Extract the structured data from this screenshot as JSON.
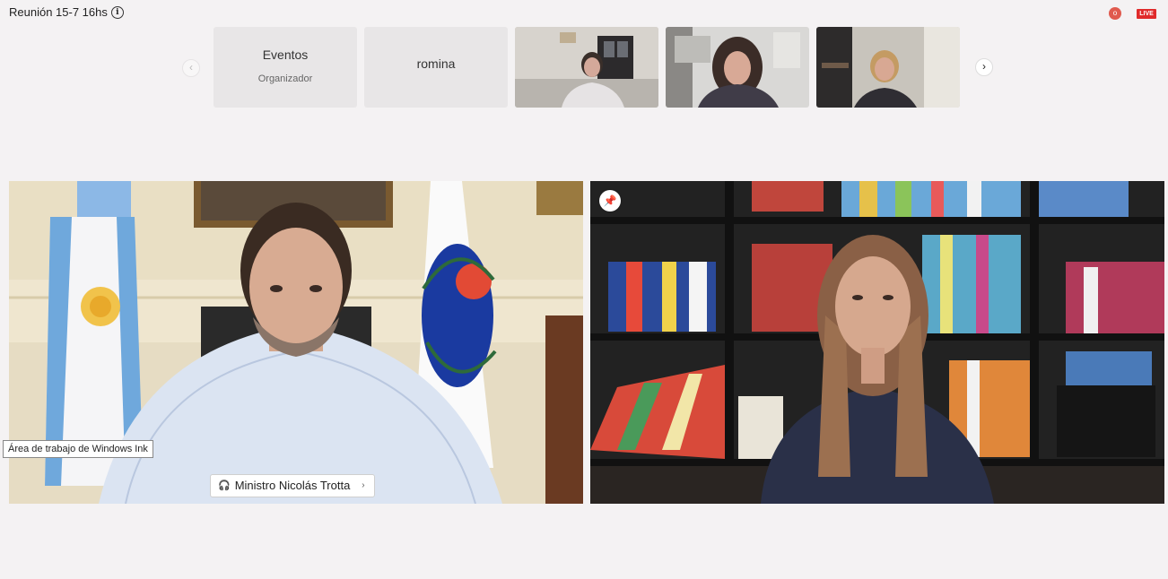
{
  "meeting": {
    "title": "Reunión 15-7 16hs"
  },
  "indicators": {
    "rec_label": "o",
    "live_label": "LIVE"
  },
  "navigation": {
    "prev_icon": "‹",
    "next_icon": "›"
  },
  "participants_strip": [
    {
      "type": "text",
      "name": "Eventos",
      "role": "Organizador"
    },
    {
      "type": "text",
      "name": "romina",
      "role": ""
    },
    {
      "type": "video",
      "name": ""
    },
    {
      "type": "video",
      "name": ""
    },
    {
      "type": "video",
      "name": ""
    }
  ],
  "main_videos": {
    "left": {
      "name_tag": "Ministro Nicolás Trotta",
      "name_chevron": "›"
    },
    "right": {
      "pin_icon": "pin-icon"
    }
  },
  "tooltip": {
    "text": "Área de trabajo de Windows Ink"
  },
  "colors": {
    "background": "#f4f2f3",
    "live": "#e02b2b",
    "rec": "#e05a4e"
  }
}
